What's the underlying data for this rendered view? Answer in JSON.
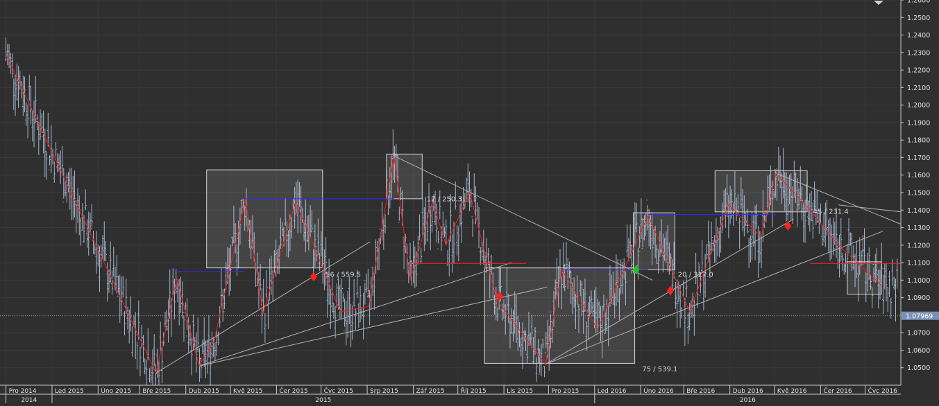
{
  "chart_data": {
    "type": "ohlc",
    "instrument_hint": "",
    "colors": {
      "background": "#2f2f2f",
      "price_bars": "#a7b6cc",
      "zigzag": "#ff1a1a",
      "resistance": "#2b2bff",
      "trendlines": "#b4b4b4",
      "boxes": "rgba(200,200,200,0.35)",
      "axis_text": "#e0e0e0",
      "current_price_tag": "#7a90b8",
      "buy_marker": "#22c02a",
      "sell_marker": "#ff2020"
    },
    "ylim": [
      1.04,
      1.26
    ],
    "yticks": [
      "1.2600",
      "1.2500",
      "1.2400",
      "1.2300",
      "1.2200",
      "1.2100",
      "1.2000",
      "1.1900",
      "1.1800",
      "1.1700",
      "1.1600",
      "1.1500",
      "1.1400",
      "1.1300",
      "1.1200",
      "1.1100",
      "1.1000",
      "1.0900",
      "1.0800",
      "1.0700",
      "1.0600",
      "1.0500"
    ],
    "current_price": "1.07969",
    "xticks": [
      {
        "label": "Pro 2014",
        "day": 0
      },
      {
        "label": "Led 2015",
        "day": 31
      },
      {
        "label": "Úno 2015",
        "day": 62
      },
      {
        "label": "Bře 2015",
        "day": 90
      },
      {
        "label": "Dub 2015",
        "day": 121
      },
      {
        "label": "Kvě 2015",
        "day": 151
      },
      {
        "label": "Čer 2015",
        "day": 182
      },
      {
        "label": "Čvc 2015",
        "day": 212
      },
      {
        "label": "Srp 2015",
        "day": 243
      },
      {
        "label": "Zář 2015",
        "day": 274
      },
      {
        "label": "Říj 2015",
        "day": 304
      },
      {
        "label": "Lis 2015",
        "day": 335
      },
      {
        "label": "Pro 2015",
        "day": 365
      },
      {
        "label": "Led 2016",
        "day": 396
      },
      {
        "label": "Úno 2016",
        "day": 427
      },
      {
        "label": "Bře 2016",
        "day": 456
      },
      {
        "label": "Dub 2016",
        "day": 487
      },
      {
        "label": "Kvě 2016",
        "day": 517
      },
      {
        "label": "Čer 2016",
        "day": 548
      },
      {
        "label": "Čvc 2016",
        "day": 578
      }
    ],
    "years": [
      {
        "label": "2014",
        "day_start": 0,
        "day_end": 31
      },
      {
        "label": "2015",
        "day_start": 31,
        "day_end": 396
      },
      {
        "label": "2016",
        "day_start": 396,
        "day_end": 602
      }
    ],
    "zigzag": [
      [
        0,
        1.229
      ],
      [
        101,
        1.047
      ],
      [
        115,
        1.101
      ],
      [
        130,
        1.051
      ],
      [
        140,
        1.065
      ],
      [
        161,
        1.146
      ],
      [
        173,
        1.081
      ],
      [
        195,
        1.145
      ],
      [
        225,
        1.082
      ],
      [
        244,
        1.085
      ],
      [
        261,
        1.171
      ],
      [
        272,
        1.1
      ],
      [
        287,
        1.145
      ],
      [
        296,
        1.12
      ],
      [
        312,
        1.15
      ],
      [
        330,
        1.089
      ],
      [
        363,
        1.052
      ],
      [
        374,
        1.106
      ],
      [
        398,
        1.072
      ],
      [
        432,
        1.137
      ],
      [
        460,
        1.082
      ],
      [
        486,
        1.143
      ],
      [
        508,
        1.125
      ],
      [
        518,
        1.161
      ],
      [
        541,
        1.14
      ],
      [
        560,
        1.12
      ],
      [
        589,
        1.097
      ]
    ],
    "resistance_lines": [
      {
        "price": 1.105,
        "from": 113,
        "to": 161
      },
      {
        "price": 1.1465,
        "from": 161,
        "to": 261
      },
      {
        "price": 1.106,
        "from": 373,
        "to": 432
      },
      {
        "price": 1.1375,
        "from": 432,
        "to": 518
      }
    ],
    "support_lines": [
      {
        "price": 1.1095,
        "from": 274,
        "to": 350
      },
      {
        "price": 1.1095,
        "from": 541,
        "to": 602
      }
    ],
    "trendlines": [
      {
        "from": [
          101,
          1.047
        ],
        "to": [
          245,
          1.122
        ]
      },
      {
        "from": [
          130,
          1.051
        ],
        "to": [
          340,
          1.11
        ]
      },
      {
        "from": [
          130,
          1.051
        ],
        "to": [
          364,
          1.096
        ]
      },
      {
        "from": [
          261,
          1.171
        ],
        "to": [
          435,
          1.1
        ]
      },
      {
        "from": [
          363,
          1.052
        ],
        "to": [
          530,
          1.135
        ]
      },
      {
        "from": [
          363,
          1.052
        ],
        "to": [
          590,
          1.128
        ]
      },
      {
        "from": [
          518,
          1.161
        ],
        "to": [
          602,
          1.132
        ]
      },
      {
        "from": [
          560,
          1.143
        ],
        "to": [
          602,
          1.139
        ]
      }
    ],
    "boxes": [
      {
        "d1": 135,
        "d2": 213,
        "p_top": 1.163,
        "p_bot": 1.107
      },
      {
        "d1": 256,
        "d2": 280,
        "p_top": 1.172,
        "p_bot": 1.1465
      },
      {
        "d1": 322,
        "d2": 423,
        "p_top": 1.107,
        "p_bot": 1.0525
      },
      {
        "d1": 422,
        "d2": 450,
        "p_top": 1.1385,
        "p_bot": 1.106
      },
      {
        "d1": 477,
        "d2": 539,
        "p_top": 1.1625,
        "p_bot": 1.139
      },
      {
        "d1": 566,
        "d2": 589,
        "p_top": 1.1105,
        "p_bot": 1.092
      }
    ],
    "annotations": [
      {
        "text": "56 / 559.5",
        "day": 215,
        "price": 1.102
      },
      {
        "text": "17 / 250.3",
        "day": 283,
        "price": 1.145
      },
      {
        "text": "75 / 539.1",
        "day": 428,
        "price": 1.048
      },
      {
        "text": "20 / 317.0",
        "day": 452,
        "price": 1.102
      },
      {
        "text": "45 / 231.4",
        "day": 543,
        "price": 1.138
      }
    ],
    "markers": [
      {
        "type": "sell",
        "day": 207,
        "price": 1.102
      },
      {
        "type": "sell",
        "day": 332,
        "price": 1.091
      },
      {
        "type": "buy",
        "day": 424,
        "price": 1.106
      },
      {
        "type": "sell",
        "day": 447,
        "price": 1.094
      },
      {
        "type": "sell",
        "day": 526,
        "price": 1.131
      }
    ]
  }
}
